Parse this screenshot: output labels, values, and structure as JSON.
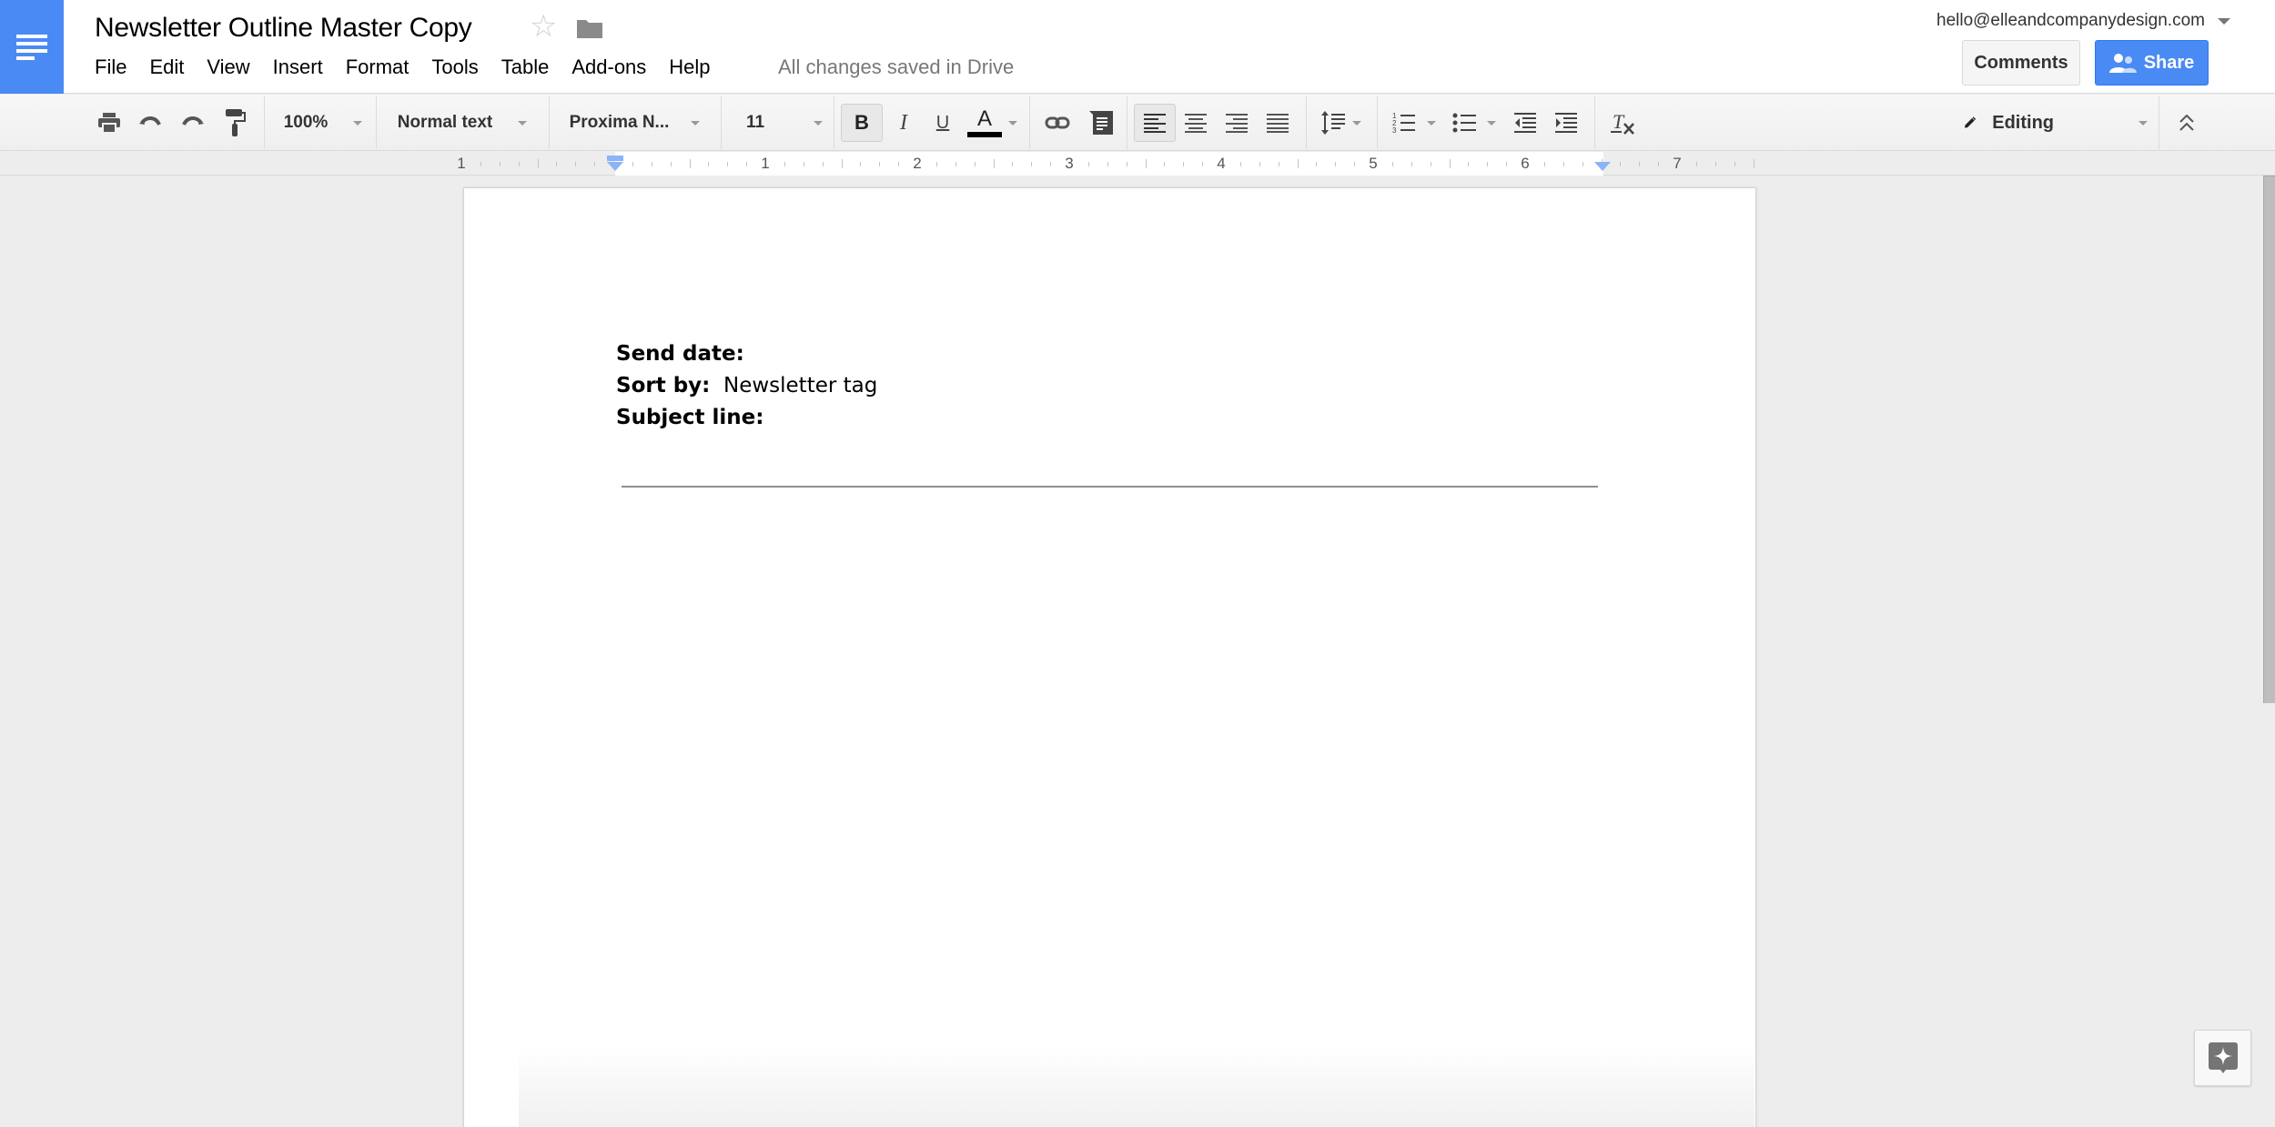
{
  "app": {
    "document_title": "Newsletter Outline Master Copy",
    "save_status": "All changes saved in Drive",
    "account_email": "hello@elleandcompanydesign.com"
  },
  "menu": {
    "items": [
      {
        "label": "File"
      },
      {
        "label": "Edit"
      },
      {
        "label": "View"
      },
      {
        "label": "Insert"
      },
      {
        "label": "Format"
      },
      {
        "label": "Tools"
      },
      {
        "label": "Table"
      },
      {
        "label": "Add-ons"
      },
      {
        "label": "Help"
      }
    ]
  },
  "header_buttons": {
    "comments_label": "Comments",
    "share_label": "Share"
  },
  "toolbar": {
    "zoom_value": "100%",
    "paragraph_style": "Normal text",
    "font_family": "Proxima N...",
    "font_size": "11",
    "bold_icon_label": "B",
    "italic_icon_label": "I",
    "underline_icon_label": "U",
    "text_color_icon_label": "A",
    "text_color": "#000000",
    "active_alignment": "left",
    "bold_active": true,
    "clear_format_label": "T",
    "mode_label": "Editing"
  },
  "ruler": {
    "labels": [
      "1",
      "1",
      "2",
      "3",
      "4",
      "5",
      "6",
      "7"
    ]
  },
  "document": {
    "lines": [
      {
        "label": "Send date:",
        "value": ""
      },
      {
        "label": "Sort by:",
        "value": "  Newsletter tag"
      },
      {
        "label": "Subject line:",
        "value": ""
      }
    ]
  },
  "colors": {
    "brand_blue": "#4a8af4",
    "indent_marker": "#8ab4f8"
  }
}
